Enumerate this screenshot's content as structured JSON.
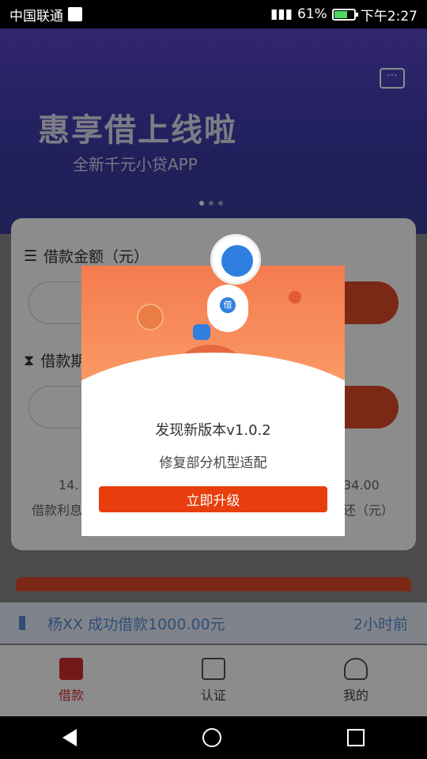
{
  "status_bar": {
    "carrier": "中国联通",
    "battery": "61%",
    "time": "下午2:27"
  },
  "banner": {
    "title": "惠享借上线啦",
    "subtitle": "全新千元小贷APP"
  },
  "form": {
    "amount_label": "借款金额（元）",
    "period_label": "借款期限",
    "stats": {
      "left_value": "14.",
      "left_label": "借款利息",
      "right_value": "34.00",
      "right_label": "还（元）"
    }
  },
  "notice": {
    "text": "杨XX 成功借款1000.00元",
    "time": "2小时前"
  },
  "tabs": [
    {
      "label": "借款",
      "active": true
    },
    {
      "label": "认证",
      "active": false
    },
    {
      "label": "我的",
      "active": false
    }
  ],
  "dialog": {
    "title": "发现新版本v1.0.2",
    "message": "修复部分机型适配",
    "button": "立即升级",
    "astronaut_badge": "借"
  },
  "colors": {
    "accent": "#e83e0e",
    "banner": "#4a3eb8",
    "notice_text": "#5a8fd6",
    "tab_active": "#d32f2f"
  }
}
